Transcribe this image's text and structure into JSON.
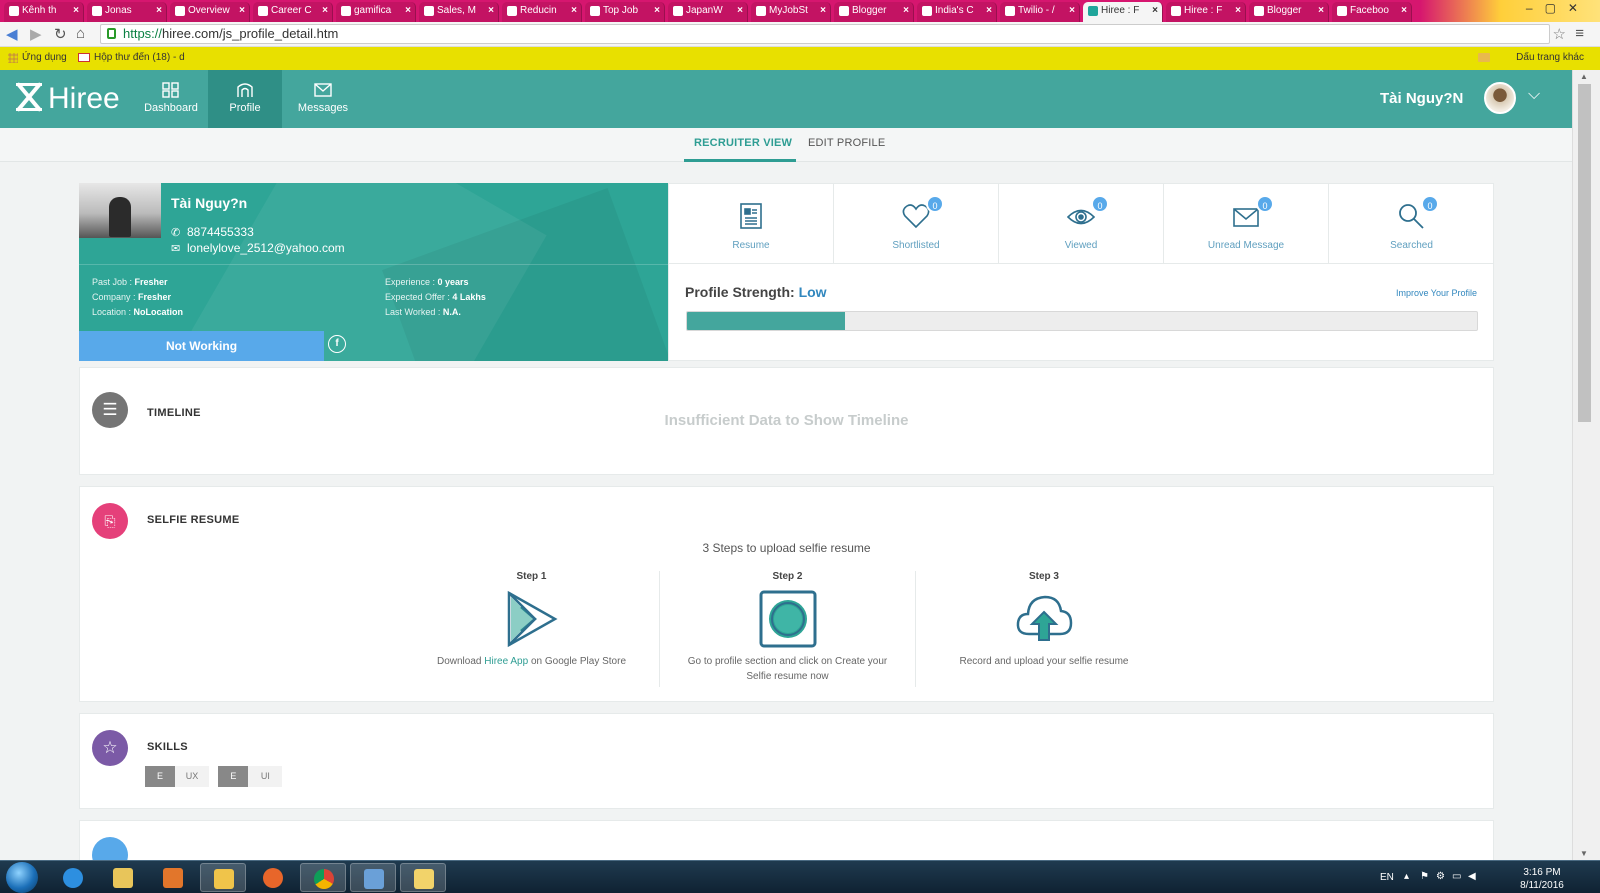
{
  "browser": {
    "tabs": [
      {
        "label": "Kênh th"
      },
      {
        "label": "Jonas"
      },
      {
        "label": "Overview"
      },
      {
        "label": "Career C"
      },
      {
        "label": "gamifica"
      },
      {
        "label": "Sales, M"
      },
      {
        "label": "Reducin"
      },
      {
        "label": "Top Job"
      },
      {
        "label": "JapanW"
      },
      {
        "label": "MyJobSt"
      },
      {
        "label": "Blogger"
      },
      {
        "label": "India's C"
      },
      {
        "label": "Twilio - /"
      },
      {
        "label": "Hiree : F"
      },
      {
        "label": "Hiree : F"
      },
      {
        "label": "Blogger"
      },
      {
        "label": "Faceboo"
      }
    ],
    "active_tab_index": 13,
    "url_scheme": "https://",
    "url_rest": "hiree.com/js_profile_detail.htm",
    "bookmarks": {
      "apps": "Ứng dụng",
      "gmail": "Hộp thư đến (18) - d",
      "other": "Dấu trang khác"
    }
  },
  "header": {
    "logo": "Hiree",
    "nav": [
      {
        "label": "Dashboard",
        "icon": "dashboard-icon"
      },
      {
        "label": "Profile",
        "icon": "profile-icon"
      },
      {
        "label": "Messages",
        "icon": "messages-icon"
      }
    ],
    "user_name": "Tài Nguy?N"
  },
  "subtabs": {
    "recruiter_view": "RECRUITER VIEW",
    "edit_profile": "EDIT PROFILE"
  },
  "profile": {
    "name": "Tài Nguy?n",
    "phone": "8874455333",
    "email": "lonelylove_2512@yahoo.com",
    "past_job_label": "Past Job : ",
    "past_job": "Fresher",
    "company_label": "Company : ",
    "company": "Fresher",
    "location_label": "Location : ",
    "location": "NoLocation",
    "experience_label": "Experience : ",
    "experience": "0 years",
    "expected_offer_label": "Expected Offer : ",
    "expected_offer": "4 Lakhs",
    "last_worked_label": "Last Worked : ",
    "last_worked": "N.A.",
    "status": "Not Working"
  },
  "stats": [
    {
      "label": "Resume",
      "icon": "resume-icon"
    },
    {
      "label": "Shortlisted",
      "count": "0",
      "icon": "heart-icon"
    },
    {
      "label": "Viewed",
      "count": "0",
      "icon": "eye-icon"
    },
    {
      "label": "Unread Message",
      "count": "0",
      "icon": "envelope-icon"
    },
    {
      "label": "Searched",
      "count": "0",
      "icon": "search-icon"
    }
  ],
  "strength": {
    "title": "Profile Strength: ",
    "level": "Low",
    "improve_link": "Improve Your Profile",
    "percent": 20
  },
  "timeline": {
    "title": "TIMELINE",
    "empty": "Insufficient Data to Show Timeline"
  },
  "selfie": {
    "title": "SELFIE RESUME",
    "heading": "3 Steps to upload selfie resume",
    "steps": [
      {
        "title": "Step 1",
        "pre": "Download ",
        "link": "Hiree App",
        "post": " on Google Play Store"
      },
      {
        "title": "Step 2",
        "desc": "Go to profile section and click on Create your Selfie resume now"
      },
      {
        "title": "Step 3",
        "desc": "Record and upload your selfie resume"
      }
    ]
  },
  "skills": {
    "title": "SKILLS",
    "items": [
      {
        "badge": "E",
        "name": "UX"
      },
      {
        "badge": "E",
        "name": "UI"
      }
    ]
  },
  "taskbar": {
    "lang": "EN",
    "time": "3:16 PM",
    "date": "8/11/2016"
  },
  "colors": {
    "brand": "#44a69d",
    "brand_dark": "#2f8f86",
    "status_blue": "#58a9ea",
    "link_blue": "#3187be"
  }
}
